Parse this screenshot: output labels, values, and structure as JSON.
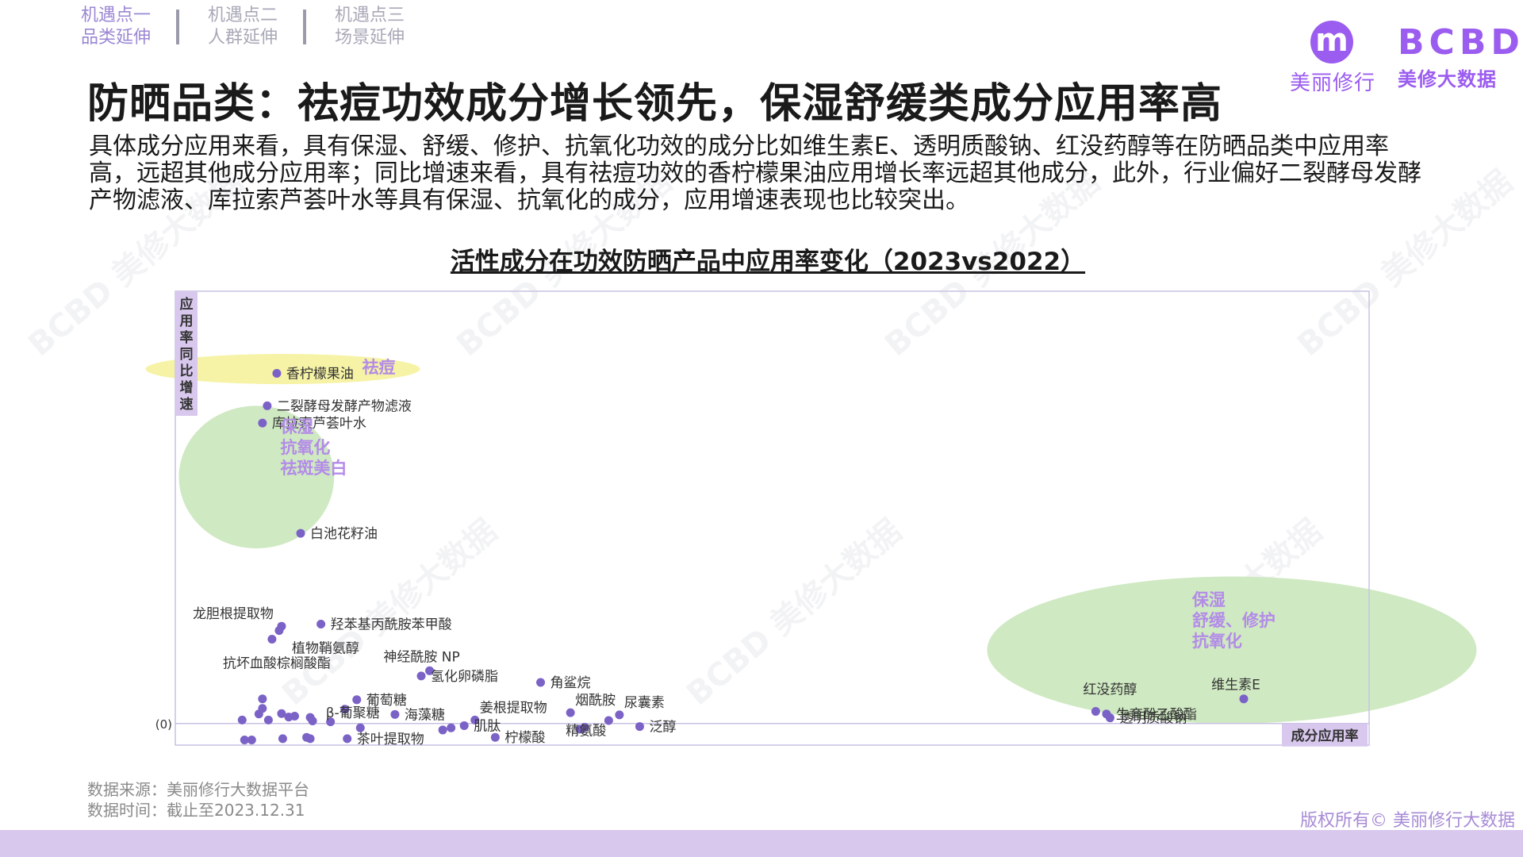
{
  "nav": [
    {
      "line1": "机遇点一",
      "line2": "品类延伸",
      "active": true
    },
    {
      "line1": "机遇点二",
      "line2": "人群延伸",
      "active": false
    },
    {
      "line1": "机遇点三",
      "line2": "场景延伸",
      "active": false
    }
  ],
  "logo": {
    "left_mark": "m",
    "left_text": "美丽修行",
    "right_mark": "BCBD",
    "right_text": "美修大数据"
  },
  "title": "防晒品类：祛痘功效成分增长领先，保湿舒缓类成分应用率高",
  "description": "具体成分应用来看，具有保湿、舒缓、修护、抗氧化功效的成分比如维生素E、透明质酸钠、红没药醇等在防晒品类中应用率高，远超其他成分应用率；同比增速来看，具有祛痘功效的香柠檬果油应用增长率远超其他成分，此外，行业偏好二裂酵母发酵产物滤液、库拉索芦荟叶水等具有保湿、抗氧化的成分，应用增速表现也比较突出。",
  "watermark": "BCBD 美修大数据",
  "footer": {
    "source": "数据来源：美丽修行大数据平台",
    "time": "数据时间：截止至2023.12.31"
  },
  "copyright": "版权所有© 美丽修行大数据",
  "colors": {
    "accent": "#9b5cf0",
    "point": "#7b62c6",
    "label_purple": "#b38be8",
    "yellow_group": "#f6f3a6",
    "green_group": "#cfe9c2",
    "axis_label_bg": "#d8c8ee"
  },
  "chart_data": {
    "type": "scatter",
    "title": "活性成分在功效防晒产品中应用率变化（2023vs2022）",
    "xlabel": "成分应用率",
    "ylabel": "应用率同比增速",
    "origin_label": "(0)",
    "xlim": [
      0,
      100
    ],
    "ylim": [
      -5,
      100
    ],
    "grid": false,
    "groups": [
      {
        "label": "祛痘",
        "shape": "ellipse",
        "color": "yellow",
        "cx": 9,
        "cy": 82,
        "rx": 11.5,
        "ry": 3.5
      },
      {
        "label": "保湿\n抗氧化\n祛斑美白",
        "shape": "ellipse",
        "color": "green",
        "cx": 6.8,
        "cy": 57,
        "rx": 6.5,
        "ry": 16.5
      },
      {
        "label": "保湿\n舒缓、修护\n抗氧化",
        "shape": "ellipse",
        "color": "green",
        "cx": 88.5,
        "cy": 17,
        "rx": 20.5,
        "ry": 17
      }
    ],
    "points": [
      {
        "name": "香柠檬果油",
        "x": 8.5,
        "y": 81,
        "label_side": "right"
      },
      {
        "name": "二裂酵母发酵产物滤液",
        "x": 7.7,
        "y": 73.5,
        "label_side": "right"
      },
      {
        "name": "库拉索芦荟叶水",
        "x": 7.3,
        "y": 69.5,
        "label_side": "right"
      },
      {
        "name": "白池花籽油",
        "x": 10.5,
        "y": 44,
        "label_side": "right"
      },
      {
        "name": "龙胆根提取物",
        "x": 8.9,
        "y": 22.5,
        "label_side": "left"
      },
      {
        "name": "羟苯基丙酰胺苯甲酸",
        "x": 12.2,
        "y": 23,
        "label_side": "right"
      },
      {
        "name": "植物鞘氨醇",
        "x": 8.7,
        "y": 21.5,
        "label_side": "right-below"
      },
      {
        "name": "抗坏血酸棕榈酸酯",
        "x": 8.1,
        "y": 19.5,
        "label_side": "below"
      },
      {
        "name": "神经酰胺 NP",
        "x": 21.3,
        "y": 12.2,
        "label_side": "above"
      },
      {
        "name": "氢化卵磷脂",
        "x": 20.6,
        "y": 11,
        "label_side": "right"
      },
      {
        "name": "角鲨烷",
        "x": 30.6,
        "y": 9.5,
        "label_side": "right"
      },
      {
        "name": "葡萄糖",
        "x": 15.2,
        "y": 5.5,
        "label_side": "right"
      },
      {
        "name": "烟酰胺",
        "x": 33.1,
        "y": 2.5,
        "label_side": "right-above"
      },
      {
        "name": "尿囊素",
        "x": 37.2,
        "y": 2,
        "label_side": "right-above"
      },
      {
        "name": "β-葡聚糖",
        "x": 14.2,
        "y": 3.3,
        "label_side": "left-below"
      },
      {
        "name": "海藻糖",
        "x": 18.4,
        "y": 2.1,
        "label_side": "right"
      },
      {
        "name": "姜根提取物",
        "x": 25.1,
        "y": 0.8,
        "label_side": "right-above"
      },
      {
        "name": "肌肽",
        "x": 24.2,
        "y": -0.5,
        "label_side": "right"
      },
      {
        "name": "泛醇",
        "x": 38.9,
        "y": -0.7,
        "label_side": "right"
      },
      {
        "name": "精氨酸",
        "x": 34.3,
        "y": -0.9,
        "label_side": "left-below"
      },
      {
        "name": "柠檬酸",
        "x": 26.8,
        "y": -3.2,
        "label_side": "right"
      },
      {
        "name": "茶叶提取物",
        "x": 14.4,
        "y": -3.5,
        "label_side": "right"
      },
      {
        "name": "红没药醇",
        "x": 77.1,
        "y": 2.8,
        "label_side": "left-above"
      },
      {
        "name": "生育酚乙酸酯",
        "x": 78,
        "y": 2.2,
        "label_side": "right"
      },
      {
        "name": "透明质酸钠",
        "x": 78.3,
        "y": 1.3,
        "label_side": "right"
      },
      {
        "name": "维生素E",
        "x": 89.5,
        "y": 5.7,
        "label_side": "above"
      },
      {
        "x": 7.3,
        "y": 5.7
      },
      {
        "x": 7.3,
        "y": 3.5
      },
      {
        "x": 7.0,
        "y": 2.2
      },
      {
        "x": 5.6,
        "y": 0.8
      },
      {
        "x": 7.8,
        "y": 0.8
      },
      {
        "x": 8.9,
        "y": 2.3
      },
      {
        "x": 10.0,
        "y": 1.7
      },
      {
        "x": 11.3,
        "y": 1.4
      },
      {
        "x": 11.5,
        "y": 0.6
      },
      {
        "x": 9.5,
        "y": 1.5
      },
      {
        "x": 13.0,
        "y": 0.4
      },
      {
        "x": 5.8,
        "y": -3.8
      },
      {
        "x": 6.4,
        "y": -3.8
      },
      {
        "x": 9.0,
        "y": -3.5
      },
      {
        "x": 11.0,
        "y": -3.2
      },
      {
        "x": 11.3,
        "y": -3.5
      },
      {
        "x": 15.5,
        "y": -1.0
      },
      {
        "x": 22.4,
        "y": -1.5
      },
      {
        "x": 23.1,
        "y": -1.0
      },
      {
        "x": 33.9,
        "y": -1.3
      },
      {
        "x": 36.3,
        "y": 0.7
      }
    ]
  }
}
